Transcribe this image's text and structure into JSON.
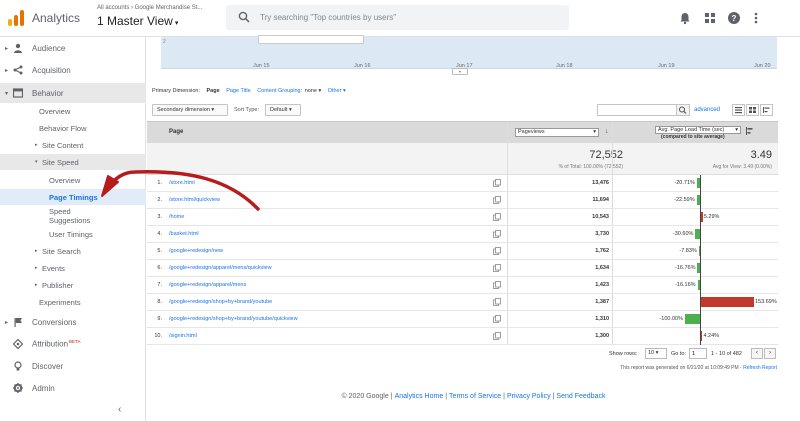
{
  "header": {
    "app_name": "Analytics",
    "accounts_path": "All accounts › Google Merchandise St...",
    "view_name": "1 Master View",
    "view_caret": "▾",
    "search_placeholder": "Try searching \"Top countries by users\"",
    "icons": [
      "bell-icon",
      "apps-grid-icon",
      "help-icon",
      "more-vert-icon"
    ]
  },
  "sidebar": {
    "items": [
      {
        "label": "Audience",
        "icon": "person-icon"
      },
      {
        "label": "Acquisition",
        "icon": "acquisition-icon"
      },
      {
        "label": "Behavior",
        "icon": "behavior-icon"
      },
      {
        "label": "Overview"
      },
      {
        "label": "Behavior Flow"
      },
      {
        "label": "Site Content"
      },
      {
        "label": "Site Speed"
      },
      {
        "label": "Overview"
      },
      {
        "label": "Page Timings"
      },
      {
        "label": "Speed\nSuggestions"
      },
      {
        "label": "User Timings"
      },
      {
        "label": "Site Search"
      },
      {
        "label": "Events"
      },
      {
        "label": "Publisher"
      },
      {
        "label": "Experiments"
      },
      {
        "label": "Conversions",
        "icon": "flag-icon"
      },
      {
        "label": "Attribution",
        "icon": "attribution-icon",
        "badge": "BETA"
      },
      {
        "label": "Discover",
        "icon": "lightbulb-icon"
      },
      {
        "label": "Admin",
        "icon": "gear-icon"
      }
    ]
  },
  "chart": {
    "y_tick": "2",
    "x_ticks": [
      "Jun 15",
      "Jun 16",
      "Jun 17",
      "Jun 18",
      "Jun 19",
      "Jun 20"
    ]
  },
  "dimensions": {
    "label": "Primary Dimension:",
    "active": "Page",
    "options": [
      "Page Title",
      "Content Grouping:",
      "none ▾",
      "Other ▾"
    ]
  },
  "controls": {
    "secondary_dimension": "Secondary dimension ▾",
    "sort_type_label": "Sort Type:",
    "sort_type_value": "Default ▾",
    "advanced": "advanced"
  },
  "table": {
    "col_page": "Page",
    "metric1": "Pageviews",
    "metric2": "Avg. Page Load Time (sec)",
    "metric2_sub": "(compared to site average)",
    "total_value": "72,552",
    "total_sub": "% of Total: 100.00% (72,552)",
    "avg_value": "3.49",
    "avg_sub": "Avg for View: 3.49 (0.00%)",
    "rows": [
      {
        "num": "1.",
        "page": "/store.html",
        "pageviews": "13,476",
        "pct_label": "-20.71%",
        "pct": -20.71
      },
      {
        "num": "2.",
        "page": "/store.html/quickview",
        "pageviews": "11,694",
        "pct_label": "-22.59%",
        "pct": -22.59
      },
      {
        "num": "3.",
        "page": "/home",
        "pageviews": "10,543",
        "pct_label": "5.29%",
        "pct": 5.29
      },
      {
        "num": "4.",
        "page": "/basket.html",
        "pageviews": "3,730",
        "pct_label": "-30.60%",
        "pct": -30.6
      },
      {
        "num": "5.",
        "page": "/google+redesign/new",
        "pageviews": "1,762",
        "pct_label": "-7.83%",
        "pct": -7.83
      },
      {
        "num": "6.",
        "page": "/google+redesign/apparel/mens/quickview",
        "pageviews": "1,634",
        "pct_label": "-16.76%",
        "pct": -16.76
      },
      {
        "num": "7.",
        "page": "/google+redesign/apparel/mens",
        "pageviews": "1,423",
        "pct_label": "-16.16%",
        "pct": -16.16
      },
      {
        "num": "8.",
        "page": "/google+redesign/shop+by+brand/youtube",
        "pageviews": "1,387",
        "pct_label": "153.69%",
        "pct": 153.69
      },
      {
        "num": "9.",
        "page": "/google+redesign/shop+by+brand/youtube/quickview",
        "pageviews": "1,310",
        "pct_label": "-100.00%",
        "pct": -100.0
      },
      {
        "num": "10.",
        "page": "/signin.html",
        "pageviews": "1,300",
        "pct_label": "4.24%",
        "pct": 4.24
      }
    ]
  },
  "pagination": {
    "show_rows_label": "Show rows:",
    "rows_value": "10 ▾",
    "goto_label": "Go to:",
    "goto_value": "1",
    "range": "1 - 10 of 482",
    "prev": "‹",
    "next": "›"
  },
  "generated": {
    "text": "This report was generated on 6/21/20 at 10:09:49 PM - ",
    "refresh": "Refresh Report"
  },
  "footer": {
    "copyright": "© 2020 Google",
    "links": [
      "Analytics Home",
      "Terms of Service",
      "Privacy Policy",
      "Send Feedback"
    ]
  },
  "colors": {
    "accent": "#1a73e8",
    "bar_negative": "#4caf50",
    "bar_positive": "#c0392b",
    "annotation_arrow": "#b71c1c"
  }
}
